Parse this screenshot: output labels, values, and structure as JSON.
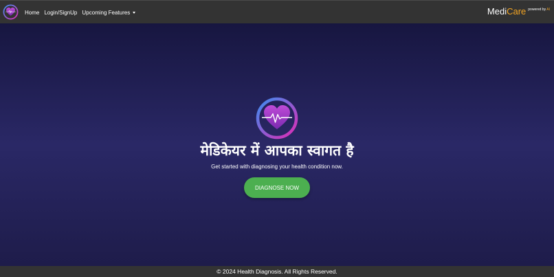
{
  "navbar": {
    "logo_icon": "heartbeat-icon",
    "links": [
      {
        "label": "Home"
      },
      {
        "label": "Login/SignUp"
      },
      {
        "label": "Upcoming Features",
        "dropdown": true
      }
    ],
    "brand": {
      "medi": "Medi",
      "care": "Care",
      "powered_prefix": "powered by",
      "powered_ai": "AI"
    }
  },
  "hero": {
    "logo_icon": "heartbeat-icon",
    "title": "मेडिकेयर में आपका स्वागत है",
    "subtitle": "Get started with diagnosing your health condition now.",
    "cta_label": "DIAGNOSE NOW"
  },
  "footer": {
    "text": "© 2024 Health Diagnosis. All Rights Reserved."
  },
  "colors": {
    "navbar_bg": "#333333",
    "brand_accent": "#f5a623",
    "cta_bg": "#4caf50",
    "hero_bg": "#2a2866",
    "logo_ring_start": "#3a8ef0",
    "logo_ring_end": "#e02bb5"
  }
}
